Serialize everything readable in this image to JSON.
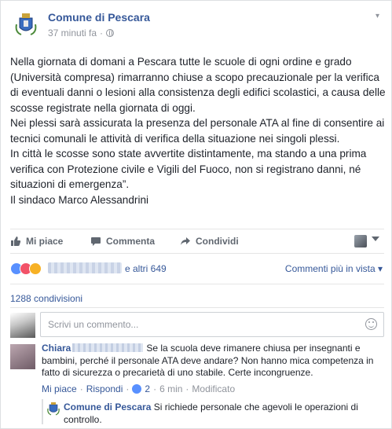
{
  "post": {
    "page_name": "Comune di Pescara",
    "time": "37 minuti fa",
    "dot": "·",
    "paragraphs": [
      "Nella giornata di domani a Pescara tutte le scuole di ogni ordine e grado (Università compresa) rimarranno chiuse a scopo precauzionale per la verifica di eventuali danni o lesioni alla consistenza degli edifici scolastici, a causa delle scosse registrate nella giornata di oggi.",
      "Nei plessi sarà assicurata la presenza del personale ATA al fine di consentire ai tecnici comunali le attività di verifica della situazione nei singoli plessi.",
      "In città le scosse sono state avvertite distintamente, ma stando a una prima verifica con Protezione civile e Vigili del Fuoco, non si registrano danni, né situazioni di emergenza”.",
      "Il sindaco Marco Alessandrini"
    ]
  },
  "actions": {
    "like": "Mi piace",
    "comment": "Commenta",
    "share": "Condividi"
  },
  "reactions": {
    "others": "e altri 649",
    "view_comments": "Commenti più in vista"
  },
  "shares": "1288 condivisioni",
  "comment_box": {
    "placeholder": "Scrivi un commento..."
  },
  "comment": {
    "author": "Chiara",
    "text": "Se la scuola deve rimanere chiusa per insegnanti e bambini, perché il personale ATA deve andare? Non hanno mica competenza in fatto di sicurezza o precarietà di uno stabile. Certe incongruenze.",
    "like": "Mi piace",
    "reply": "Rispondi",
    "sep": "·",
    "likes": "2",
    "age": "6 min",
    "edited": "Modificato"
  },
  "reply": {
    "author": "Comune di Pescara",
    "text": "Si richiede personale che agevoli le operazioni di controllo."
  },
  "colors": {
    "link": "#365899",
    "meta": "#90949c",
    "like_blue": "#5890ff"
  },
  "icons": [
    "crest-icon",
    "globe-icon",
    "thumbs-up-icon",
    "comment-icon",
    "share-icon",
    "smiley-icon"
  ]
}
